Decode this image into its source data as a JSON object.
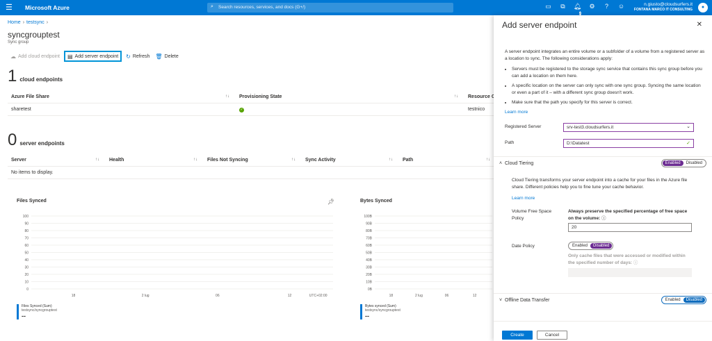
{
  "topbar": {
    "brand": "Microsoft Azure",
    "search_placeholder": "Search resources, services, and docs (G+/)",
    "notif_count": "2",
    "user_email": "n.giusto@cloudsurfers.it",
    "user_org": "FONTANA MARCO IT CONSULTING"
  },
  "breadcrumb": {
    "home": "Home",
    "item": "testsync"
  },
  "page": {
    "title": "syncgrouptest",
    "subtitle": "Sync group"
  },
  "toolbar": {
    "add_cloud": "Add cloud endpoint",
    "add_server": "Add server endpoint",
    "refresh": "Refresh",
    "delete": "Delete"
  },
  "cloud": {
    "count": "1",
    "label": "cloud endpoints",
    "headers": [
      "Azure File Share",
      "Provisioning State",
      "Resource Gro"
    ],
    "rows": [
      {
        "share": "sharetest",
        "state": "ok",
        "rg": "testnico"
      }
    ]
  },
  "server": {
    "count": "0",
    "label": "server endpoints",
    "headers": [
      "Server",
      "Health",
      "Files Not Syncing",
      "Sync Activity",
      "Path"
    ],
    "empty": "No items to display."
  },
  "charts": [
    {
      "title": "Files Synced",
      "yticks": [
        "100",
        "90",
        "80",
        "70",
        "60",
        "50",
        "40",
        "30",
        "20",
        "10",
        "0"
      ],
      "xticks": [
        "18",
        "2 lug",
        "06",
        "12",
        "UTC+02:00"
      ],
      "legend_series": "Files Synced (Sum)",
      "legend_resource": "testsync/syncgrouptest",
      "legend_value": "--"
    },
    {
      "title": "Bytes Synced",
      "yticks": [
        "100B",
        "90B",
        "80B",
        "70B",
        "60B",
        "50B",
        "40B",
        "30B",
        "20B",
        "10B",
        "0B"
      ],
      "xticks": [
        "18",
        "2 lug",
        "06",
        "12"
      ],
      "legend_series": "Bytes synced (Sum)",
      "legend_resource": "testsync/syncgrouptest",
      "legend_value": "--"
    }
  ],
  "panel": {
    "title": "Add server endpoint",
    "intro": "A server endpoint integrates an entire volume or a subfolder of a volume from a registered server as a location to sync. The following considerations apply:",
    "bullets": [
      "Servers must be registered to the storage sync service that contains this sync group before you can add a location on them here.",
      "A specific location on the server can only sync with one sync group. Syncing the same location or even a part of it – with a different sync group doesn't work.",
      "Make sure that the path you specify for this server is correct."
    ],
    "learn_more": "Learn more",
    "registered_server_label": "Registered Server",
    "registered_server_value": "srv-test3.cloudsurfers.it",
    "path_label": "Path",
    "path_value": "D:\\Datatest",
    "cloud_tiering": {
      "title": "Cloud Tiering",
      "enabled": "Enabled",
      "disabled": "Disabled",
      "description": "Cloud Tiering transforms your server endpoint into a cache for your files in the Azure file share. Different policies help you to fine tune your cache behavior.",
      "learn_more": "Learn more",
      "vfs_label": "Volume Free Space Policy",
      "vfs_desc": "Always preserve the specified percentage of free space on the volume:",
      "vfs_value": "20",
      "date_label": "Date Policy",
      "date_enabled": "Enabled",
      "date_disabled": "Disabled",
      "date_desc": "Only cache files that were accessed or modified within the specified number of days:"
    },
    "offline": {
      "title": "Offline Data Transfer",
      "enabled": "Enabled",
      "disabled": "Disabled"
    },
    "create": "Create",
    "cancel": "Cancel"
  }
}
